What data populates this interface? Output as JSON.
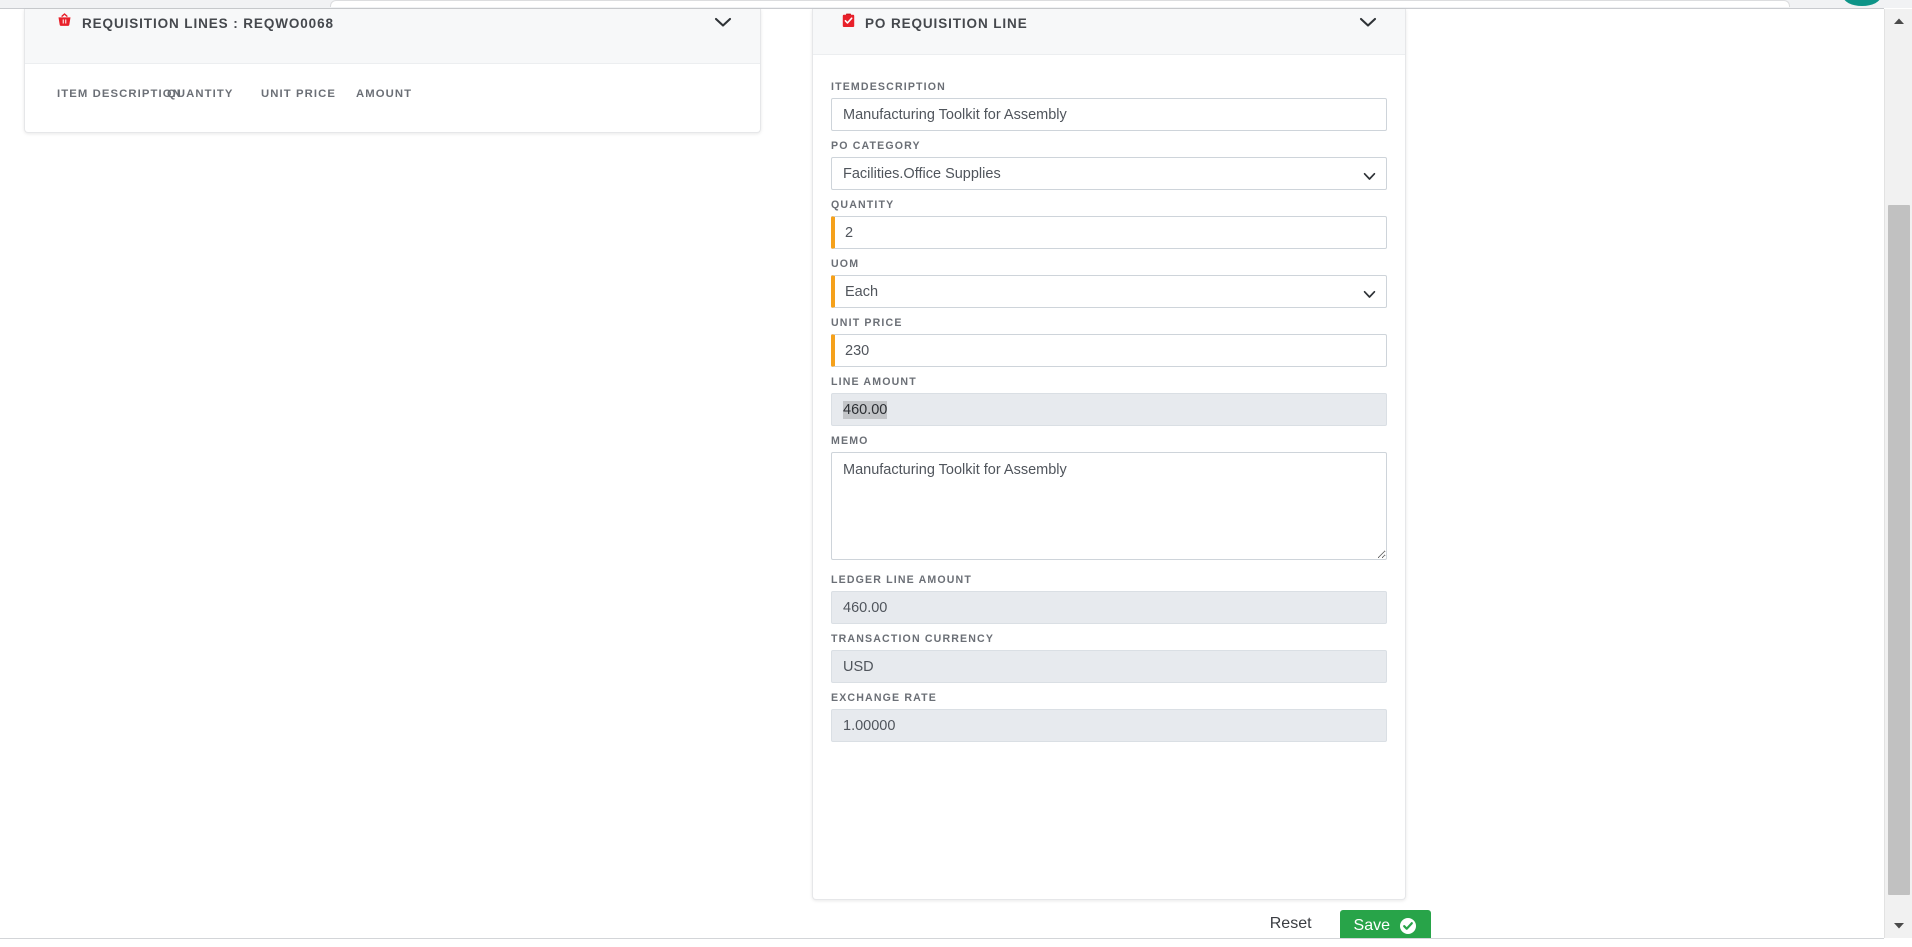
{
  "requisition_lines_card": {
    "icon": "shopping-basket-icon",
    "icon_color": "#e8202a",
    "title": "REQUISITION LINES : REQWO0068",
    "collapse_icon": "chevron-down-icon",
    "columns": [
      "ITEM DESCRIPTION",
      "QUANTITY",
      "UNIT PRICE",
      "AMOUNT"
    ],
    "rows": []
  },
  "po_requisition_line_card": {
    "icon": "clipboard-check-icon",
    "icon_color": "#e8202a",
    "title": "PO REQUISITION LINE",
    "collapse_icon": "chevron-down-icon",
    "fields": {
      "item_description": {
        "label": "ITEMDESCRIPTION",
        "value": "Manufacturing Toolkit for Assembly",
        "placeholder": "",
        "required": false,
        "readonly": false
      },
      "po_category": {
        "label": "PO CATEGORY",
        "value": "Facilities.Office Supplies",
        "options": [
          "Facilities.Office Supplies"
        ],
        "required": false,
        "readonly": false,
        "icon": "chevron-down-icon"
      },
      "quantity": {
        "label": "QUANTITY",
        "value": "2",
        "placeholder": "",
        "required": true,
        "readonly": false
      },
      "uom": {
        "label": "UOM",
        "value": "Each",
        "options": [
          "Each"
        ],
        "required": true,
        "readonly": false,
        "icon": "chevron-down-icon"
      },
      "unit_price": {
        "label": "UNIT PRICE",
        "value": "230",
        "placeholder": "",
        "required": true,
        "readonly": false
      },
      "line_amount": {
        "label": "LINE AMOUNT",
        "value": "460.00",
        "required": false,
        "readonly": true,
        "text_selected": true
      },
      "memo": {
        "label": "MEMO",
        "value": "Manufacturing Toolkit for Assembly",
        "placeholder": "",
        "required": false,
        "readonly": false,
        "resize_handle": "resize-grip-icon"
      },
      "ledger_line_amount": {
        "label": "LEDGER LINE AMOUNT",
        "value": "460.00",
        "required": false,
        "readonly": true
      },
      "transaction_currency": {
        "label": "TRANSACTION CURRENCY",
        "value": "USD",
        "required": false,
        "readonly": true
      },
      "exchange_rate": {
        "label": "EXCHANGE RATE",
        "value": "1.00000",
        "required": false,
        "readonly": true
      }
    }
  },
  "footer": {
    "reset_label": "Reset",
    "save_label": "Save",
    "save_icon": "check-circle-icon",
    "save_color": "#28a449"
  },
  "scrollbar": {
    "up_icon": "scroll-up-arrow-icon",
    "down_icon": "scroll-down-arrow-icon"
  },
  "colors": {
    "required_marker": "#f5a11b",
    "card_header_bg": "#f7f8f9",
    "readonly_bg": "#e7eaee",
    "accent_teal": "#0d9488"
  }
}
